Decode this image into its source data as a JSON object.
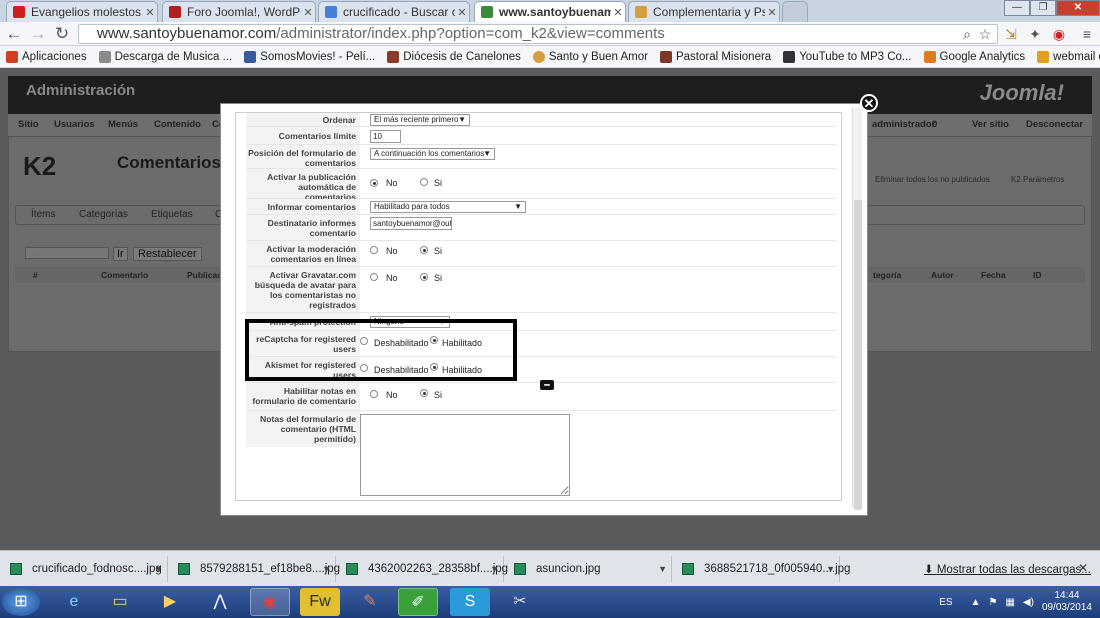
{
  "browser": {
    "tabs": [
      {
        "title": "Evangelios molestos - ",
        "fav": "youtube-icon",
        "color": "#cc2020"
      },
      {
        "title": "Foro Joomla!, WordPress y",
        "fav": "joomla-forum-icon",
        "color": "#b02020"
      },
      {
        "title": "crucificado - Buscar con G",
        "fav": "google-icon",
        "color": "#4a7fd8"
      },
      {
        "title": "www.santoybuenamor.co",
        "fav": "site-icon",
        "color": "#3a8a3a"
      },
      {
        "title": "Complementaria y Psicóp",
        "fav": "site-icon",
        "color": "#d2a040"
      }
    ],
    "url_domain": "www.santoybuenamor.com",
    "url_path": "/administrator/index.php?option=com_k2&view=comments",
    "bookmarks": [
      {
        "label": "Aplicaciones",
        "color": "#d04020"
      },
      {
        "label": "Descarga de Musica ...",
        "color": "#8a8a8a"
      },
      {
        "label": "SomosMovies! - Pelí...",
        "color": "#3a5a9a"
      },
      {
        "label": "Diócesis de Canelones",
        "color": "#8a3a2a"
      },
      {
        "label": "Santo y Buen Amor",
        "color": "#d0a040"
      },
      {
        "label": "Pastoral Misionera",
        "color": "#7a3a2a"
      },
      {
        "label": "YouTube to MP3 Co...",
        "color": "#333333"
      },
      {
        "label": "Google Analytics",
        "color": "#e07a20"
      },
      {
        "label": "webmail diocesis",
        "color": "#e0a020"
      }
    ]
  },
  "admin": {
    "title": "Administración",
    "brand": "Joomla!",
    "menu": [
      "Sitio",
      "Usuarios",
      "Menús",
      "Contenido",
      "Co"
    ],
    "user_items": [
      "administrador",
      "0",
      "Ver sitio",
      "Desconectar"
    ],
    "k2_logo": "K2",
    "page_title": "Comentarios",
    "tabs": [
      "Ítems",
      "Categorías",
      "Etiquetas",
      "C"
    ],
    "filter_placeholder": "Filtro",
    "go_button": "Ir",
    "reset_button": "Restablecer",
    "columns_left": [
      "#",
      "Comentario",
      "Publicad"
    ],
    "columns_right": [
      "tegoría",
      "Autor",
      "Fecha",
      "ID"
    ],
    "toolbar_right": [
      "Eliminar todos los no publicados",
      "K2 Parámetros"
    ]
  },
  "modal": {
    "rows": [
      {
        "label": "Ordenar",
        "type": "select",
        "value": "El más reciente primero"
      },
      {
        "label": "Comentarios límite",
        "type": "text",
        "value": "10"
      },
      {
        "label": "Posición del formulario de comentarios",
        "type": "select",
        "value": "A continuación los comentarios"
      },
      {
        "label": "Activar la publicación automática de comentarios",
        "type": "radio",
        "options": [
          "No",
          "Si"
        ],
        "selected": 0
      },
      {
        "label": "Informar comentarios",
        "type": "select",
        "value": "Habilitado para todos"
      },
      {
        "label": "Destinatario informes comentario",
        "type": "text",
        "value": "santoybuenamor@outlo"
      },
      {
        "label": "Activar la moderación comentarios en línea",
        "type": "radio",
        "options": [
          "No",
          "Si"
        ],
        "selected": 1
      },
      {
        "label": "Activar Gravatar.com búsqueda de avatar para los comentaristas no registrados",
        "type": "radio",
        "options": [
          "No",
          "Si"
        ],
        "selected": 1
      },
      {
        "label": "Anti-spam protection",
        "type": "select",
        "value": "Ninguno"
      },
      {
        "label": "reCaptcha for registered users",
        "type": "radio",
        "options": [
          "Deshabilitado",
          "Habilitado"
        ],
        "selected": 1
      },
      {
        "label": "Akismet for registered users",
        "type": "radio",
        "options": [
          "Deshabilitado",
          "Habilitado"
        ],
        "selected": 1
      },
      {
        "label": "Habilitar notas en formulario de comentario",
        "type": "radio",
        "options": [
          "No",
          "Si"
        ],
        "selected": 1
      },
      {
        "label": "Notas del formulario de comentario (HTML permitido)",
        "type": "textarea",
        "value": ""
      }
    ]
  },
  "downloads": {
    "items": [
      "crucificado_fodnosc....jpg",
      "8579288151_ef18be8....jpg",
      "4362002263_28358bf....jpg",
      "asuncion.jpg",
      "3688521718_0f005940....jpg"
    ],
    "show_all": "Mostrar todas las descargas..."
  },
  "taskbar": {
    "lang": "ES",
    "time": "14:44",
    "date": "09/03/2014"
  }
}
